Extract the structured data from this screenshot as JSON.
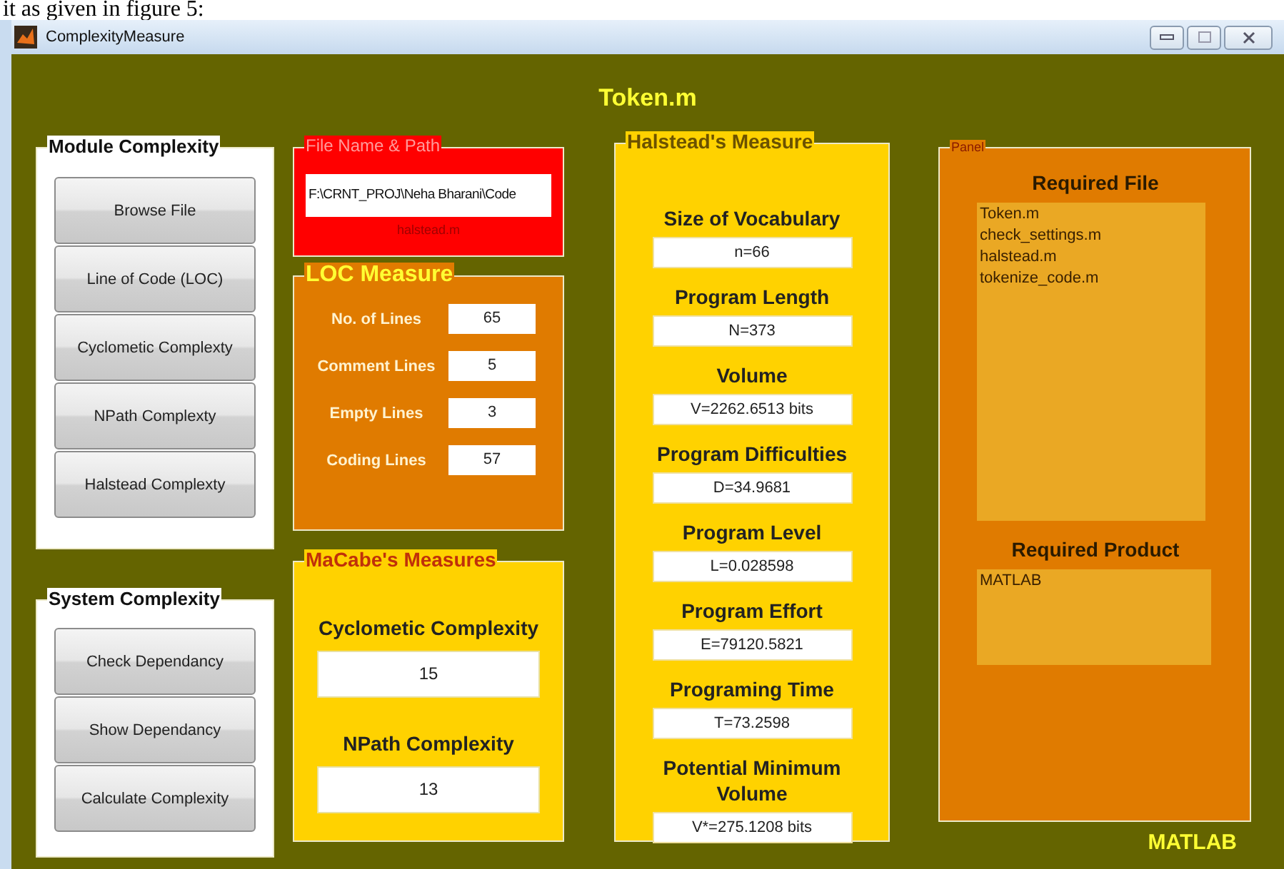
{
  "document_caption": "it as given in figure 5:",
  "window": {
    "title": "ComplexityMeasure"
  },
  "heading": "Token.m",
  "module_panel": {
    "title": "Module Complexity",
    "buttons": [
      "Browse File",
      "Line of Code (LOC)",
      "Cyclometic Complexty",
      "NPath Complexty",
      "Halstead Complexty"
    ]
  },
  "system_panel": {
    "title": "System Complexity",
    "buttons": [
      "Check Dependancy",
      "Show Dependancy",
      "Calculate Complexity"
    ]
  },
  "file_panel": {
    "title": "File Name & Path",
    "path_value": "F:\\CRNT_PROJ\\Neha Bharani\\Code",
    "file_name": "halstead.m"
  },
  "loc_panel": {
    "title": "LOC Measure",
    "rows": [
      {
        "label": "No. of Lines",
        "value": "65"
      },
      {
        "label": "Comment Lines",
        "value": "5"
      },
      {
        "label": "Empty Lines",
        "value": "3"
      },
      {
        "label": "Coding Lines",
        "value": "57"
      }
    ]
  },
  "mccabe_panel": {
    "title": "MaCabe's Measures",
    "rows": [
      {
        "label": "Cyclometic Complexity",
        "value": "15"
      },
      {
        "label": "NPath Complexity",
        "value": "13"
      }
    ]
  },
  "halstead_panel": {
    "title": "Halstead's Measure",
    "rows": [
      {
        "label": "Size of Vocabulary",
        "value": "n=66"
      },
      {
        "label": "Program Length",
        "value": "N=373"
      },
      {
        "label": "Volume",
        "value": "V=2262.6513 bits"
      },
      {
        "label": "Program Difficulties",
        "value": "D=34.9681"
      },
      {
        "label": "Program Level",
        "value": "L=0.028598"
      },
      {
        "label": "Program Effort",
        "value": "E=79120.5821"
      },
      {
        "label": "Programing Time",
        "value": "T=73.2598"
      },
      {
        "label": "Potential Minimum Volume",
        "value": "V*=275.1208 bits"
      }
    ]
  },
  "info_panel": {
    "title": "Panel",
    "sections": [
      {
        "heading": "Required File",
        "items": [
          "Token.m",
          "check_settings.m",
          "halstead.m",
          "tokenize_code.m"
        ]
      },
      {
        "heading": "Required Product",
        "items": [
          "MATLAB"
        ]
      }
    ]
  },
  "footer_label": "MATLAB"
}
